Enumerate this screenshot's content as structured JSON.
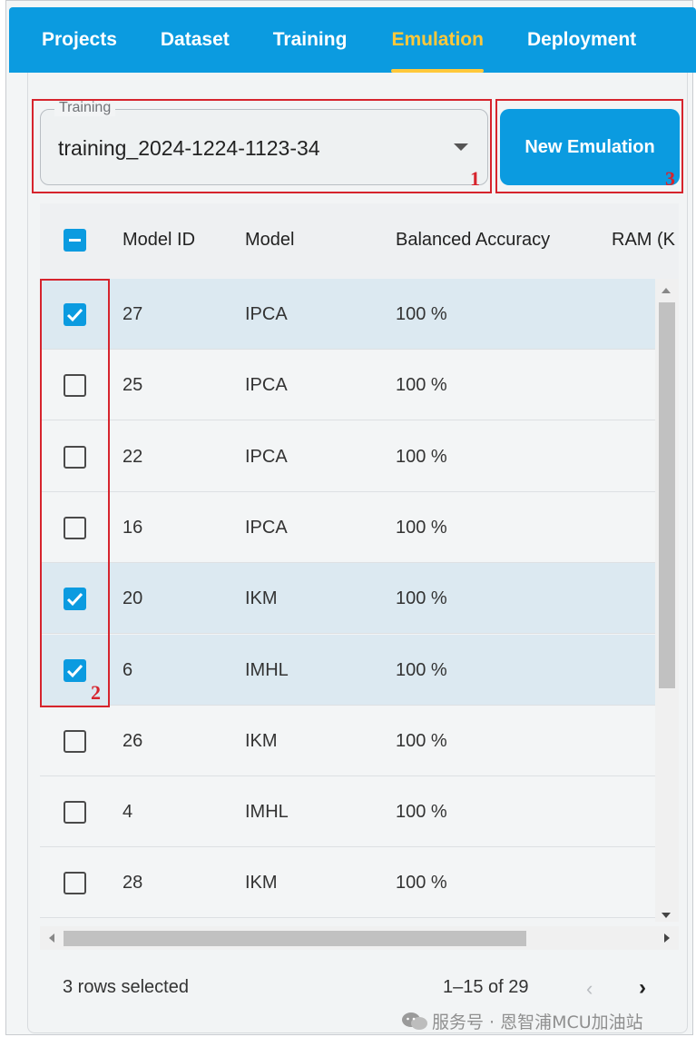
{
  "nav": {
    "tabs": [
      {
        "label": "Projects",
        "active": false
      },
      {
        "label": "Dataset",
        "active": false
      },
      {
        "label": "Training",
        "active": false
      },
      {
        "label": "Emulation",
        "active": true
      },
      {
        "label": "Deployment",
        "active": false
      }
    ]
  },
  "training_select": {
    "legend": "Training",
    "value": "training_2024-1224-1123-34"
  },
  "new_emulation_button": "New Emulation",
  "annotations": [
    "1",
    "2",
    "3"
  ],
  "table": {
    "columns": [
      "Model ID",
      "Model",
      "Balanced Accuracy",
      "RAM (K"
    ],
    "rows": [
      {
        "id": "27",
        "model": "IPCA",
        "accuracy": "100 %",
        "selected": true
      },
      {
        "id": "25",
        "model": "IPCA",
        "accuracy": "100 %",
        "selected": false
      },
      {
        "id": "22",
        "model": "IPCA",
        "accuracy": "100 %",
        "selected": false
      },
      {
        "id": "16",
        "model": "IPCA",
        "accuracy": "100 %",
        "selected": false
      },
      {
        "id": "20",
        "model": "IKM",
        "accuracy": "100 %",
        "selected": true
      },
      {
        "id": "6",
        "model": "IMHL",
        "accuracy": "100 %",
        "selected": true
      },
      {
        "id": "26",
        "model": "IKM",
        "accuracy": "100 %",
        "selected": false
      },
      {
        "id": "4",
        "model": "IMHL",
        "accuracy": "100 %",
        "selected": false
      },
      {
        "id": "28",
        "model": "IKM",
        "accuracy": "100 %",
        "selected": false
      }
    ]
  },
  "footer": {
    "selected_text": "3 rows selected",
    "pagination": "1–15 of 29"
  },
  "watermark": "服务号 · 恩智浦MCU加油站",
  "colors": {
    "primary": "#0b9be0",
    "active_tab": "#ffc83a",
    "annotation": "#d6242d",
    "selected_row": "#dce9f1"
  }
}
